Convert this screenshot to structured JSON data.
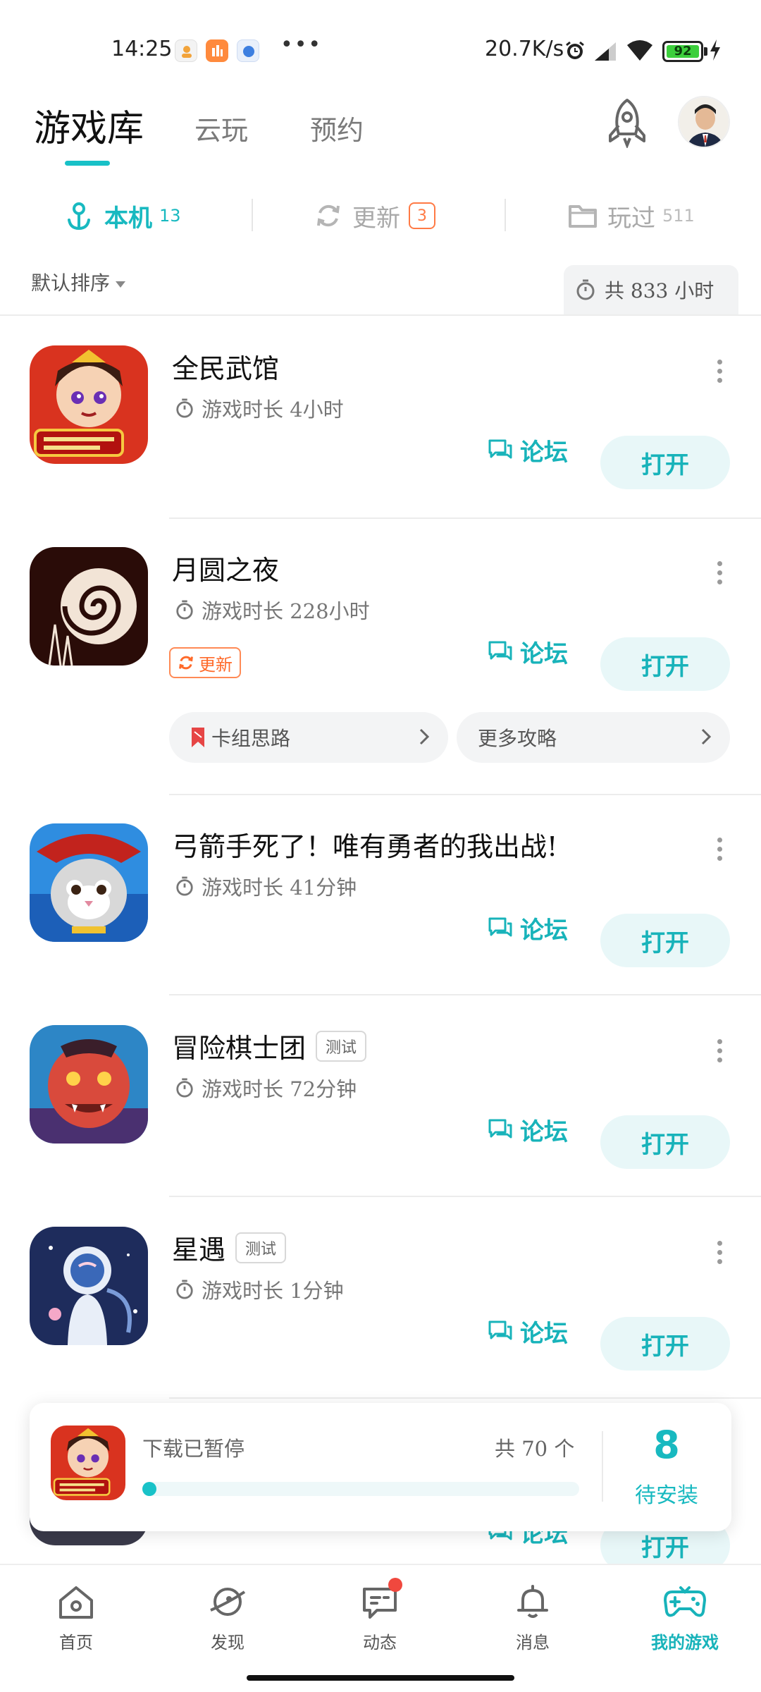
{
  "status_bar": {
    "time": "14:25",
    "more": "•••",
    "net_speed": "20.7K/s",
    "battery": "92",
    "icons": [
      "notification-app-icon",
      "alarm-icon",
      "signal-icon",
      "wifi-icon",
      "battery-icon",
      "charging-icon"
    ]
  },
  "header": {
    "tabs": [
      "游戏库",
      "云玩",
      "预约"
    ],
    "active_tab": "游戏库",
    "accent": "#18b9c0"
  },
  "subtabs": {
    "local": {
      "label": "本机",
      "count": "13"
    },
    "update": {
      "label": "更新",
      "count": "3"
    },
    "played": {
      "label": "玩过",
      "count": "511"
    }
  },
  "sort": {
    "label": "默认排序",
    "total": "共 833 小时"
  },
  "games": [
    {
      "name": "全民武馆",
      "time": "游戏时长 4小时",
      "forum": "论坛",
      "open": "打开"
    },
    {
      "name": "月圆之夜",
      "time": "游戏时长 228小时",
      "forum": "论坛",
      "open": "打开",
      "update": "更新",
      "guides": [
        "卡组思路",
        "更多攻略"
      ]
    },
    {
      "name": "弓箭手死了！唯有勇者的我出战!",
      "time": "游戏时长 41分钟",
      "forum": "论坛",
      "open": "打开"
    },
    {
      "name": "冒险棋士团",
      "tag": "测试",
      "time": "游戏时长 72分钟",
      "forum": "论坛",
      "open": "打开"
    },
    {
      "name": "星遇",
      "tag": "测试",
      "time": "游戏时长 1分钟",
      "forum": "论坛",
      "open": "打开"
    },
    {
      "forum": "论坛",
      "open": "打开"
    }
  ],
  "download": {
    "status": "下载已暂停",
    "total": "共 70 个",
    "progress": 0.02,
    "pending_count": "8",
    "pending_label": "待安装"
  },
  "bottom_nav": [
    {
      "label": "首页",
      "icon": "home-icon"
    },
    {
      "label": "发现",
      "icon": "planet-icon"
    },
    {
      "label": "动态",
      "icon": "chat-icon",
      "badge": true
    },
    {
      "label": "消息",
      "icon": "bell-icon"
    },
    {
      "label": "我的游戏",
      "icon": "gamepad-icon",
      "active": true
    }
  ]
}
